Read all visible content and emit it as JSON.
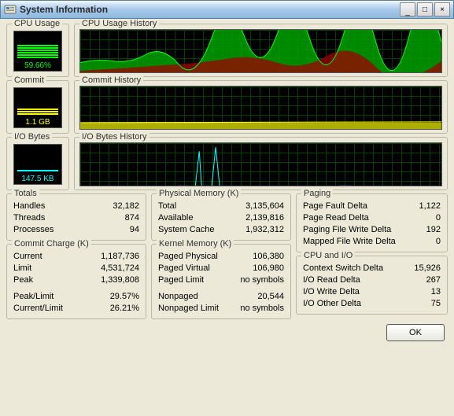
{
  "window": {
    "title": "System Information",
    "min": "_",
    "max": "□",
    "close": "×"
  },
  "gauges": {
    "cpu": {
      "legend": "CPU Usage",
      "value": "59.66%",
      "color": "#00ff00"
    },
    "commit": {
      "legend": "Commit",
      "value": "1.1 GB",
      "color": "#ffff00"
    },
    "io": {
      "legend": "I/O Bytes",
      "value": "147.5  KB",
      "color": "#00ffff"
    }
  },
  "histories": {
    "cpu": "CPU Usage History",
    "commit": "Commit History",
    "io": "I/O Bytes History"
  },
  "totals": {
    "legend": "Totals",
    "handles": {
      "label": "Handles",
      "value": "32,182"
    },
    "threads": {
      "label": "Threads",
      "value": "874"
    },
    "processes": {
      "label": "Processes",
      "value": "94"
    }
  },
  "commitCharge": {
    "legend": "Commit Charge (K)",
    "current": {
      "label": "Current",
      "value": "1,187,736"
    },
    "limit": {
      "label": "Limit",
      "value": "4,531,724"
    },
    "peak": {
      "label": "Peak",
      "value": "1,339,808"
    },
    "peakLimit": {
      "label": "Peak/Limit",
      "value": "29.57%"
    },
    "currentLimit": {
      "label": "Current/Limit",
      "value": "26.21%"
    }
  },
  "physMem": {
    "legend": "Physical Memory (K)",
    "total": {
      "label": "Total",
      "value": "3,135,604"
    },
    "available": {
      "label": "Available",
      "value": "2,139,816"
    },
    "cache": {
      "label": "System Cache",
      "value": "1,932,312"
    }
  },
  "kernelMem": {
    "legend": "Kernel Memory (K)",
    "pagedPhys": {
      "label": "Paged Physical",
      "value": "106,380"
    },
    "pagedVirt": {
      "label": "Paged Virtual",
      "value": "106,980"
    },
    "pagedLimit": {
      "label": "Paged Limit",
      "value": "no symbols"
    },
    "nonpaged": {
      "label": "Nonpaged",
      "value": "20,544"
    },
    "nonpagedLimit": {
      "label": "Nonpaged Limit",
      "value": "no symbols"
    }
  },
  "paging": {
    "legend": "Paging",
    "pfd": {
      "label": "Page Fault Delta",
      "value": "1,122"
    },
    "prd": {
      "label": "Page Read Delta",
      "value": "0"
    },
    "pfwd": {
      "label": "Paging File Write Delta",
      "value": "192"
    },
    "mfwd": {
      "label": "Mapped File Write Delta",
      "value": "0"
    }
  },
  "cpuio": {
    "legend": "CPU and I/O",
    "csd": {
      "label": "Context Switch Delta",
      "value": "15,926"
    },
    "ird": {
      "label": "I/O Read Delta",
      "value": "267"
    },
    "iwd": {
      "label": "I/O Write Delta",
      "value": "13"
    },
    "iod": {
      "label": "I/O Other Delta",
      "value": "75"
    }
  },
  "buttons": {
    "ok": "OK"
  }
}
